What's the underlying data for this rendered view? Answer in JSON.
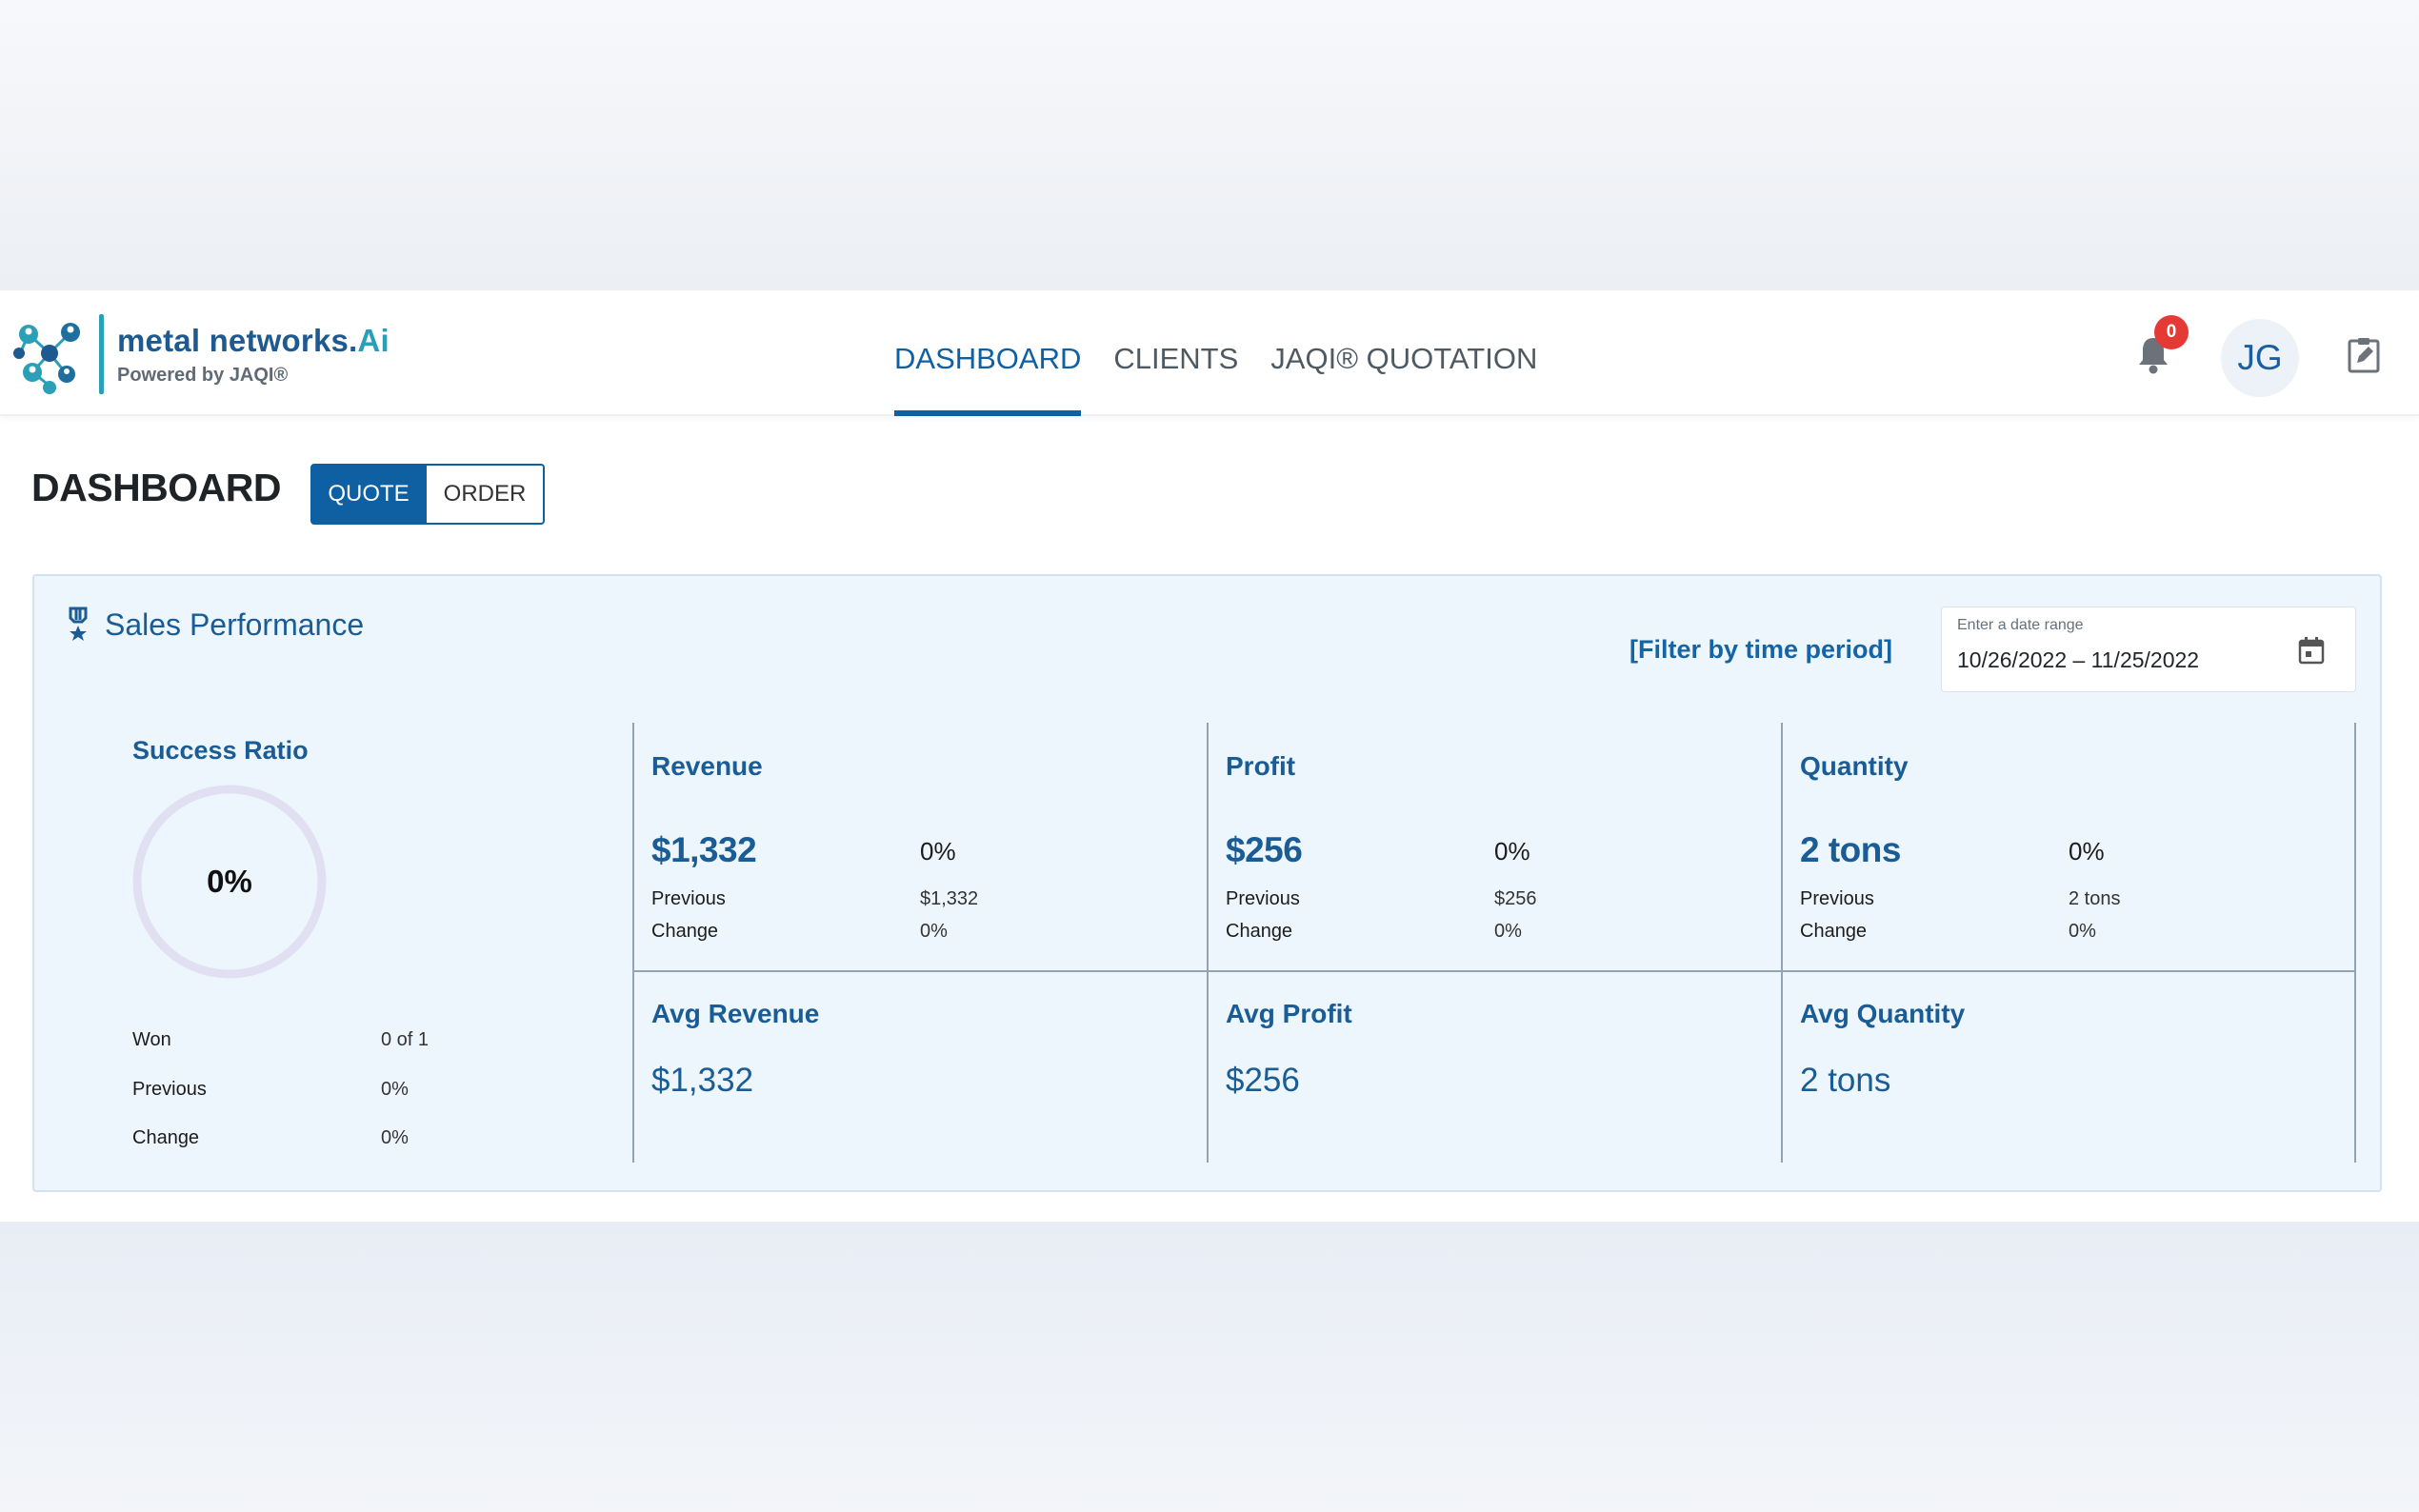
{
  "header": {
    "logo": {
      "name_main": "metal networks.",
      "name_accent": "Ai",
      "subtitle": "Powered by JAQI®"
    },
    "nav": [
      "DASHBOARD",
      "CLIENTS",
      "JAQI® QUOTATION"
    ],
    "active_nav": "DASHBOARD",
    "notifications_count": "0",
    "avatar_initials": "JG"
  },
  "page": {
    "title": "DASHBOARD",
    "toggle": {
      "quote": "QUOTE",
      "order": "ORDER",
      "selected": "QUOTE"
    }
  },
  "panel": {
    "title": "Sales Performance",
    "filter_link": "[Filter by time period]",
    "date_range": {
      "label": "Enter a date range",
      "value": "10/26/2022 – 11/25/2022"
    },
    "success_ratio": {
      "title": "Success Ratio",
      "value": "0%",
      "rows": [
        {
          "label": "Won",
          "value": "0 of 1"
        },
        {
          "label": "Previous",
          "value": "0%"
        },
        {
          "label": "Change",
          "value": "0%"
        }
      ]
    },
    "metrics": [
      {
        "title": "Revenue",
        "value": "$1,332",
        "pct": "0%",
        "previous_label": "Previous",
        "previous": "$1,332",
        "change_label": "Change",
        "change": "0%"
      },
      {
        "title": "Profit",
        "value": "$256",
        "pct": "0%",
        "previous_label": "Previous",
        "previous": "$256",
        "change_label": "Change",
        "change": "0%"
      },
      {
        "title": "Quantity",
        "value": "2 tons",
        "pct": "0%",
        "previous_label": "Previous",
        "previous": "2 tons",
        "change_label": "Change",
        "change": "0%"
      }
    ],
    "averages": [
      {
        "title": "Avg Revenue",
        "value": "$1,332"
      },
      {
        "title": "Avg Profit",
        "value": "$256"
      },
      {
        "title": "Avg Quantity",
        "value": "2 tons"
      }
    ]
  },
  "colors": {
    "primary": "#0f5fa3",
    "accent": "#2a9fb8",
    "badge": "#e53935",
    "panel_bg": "#eef6fd"
  }
}
